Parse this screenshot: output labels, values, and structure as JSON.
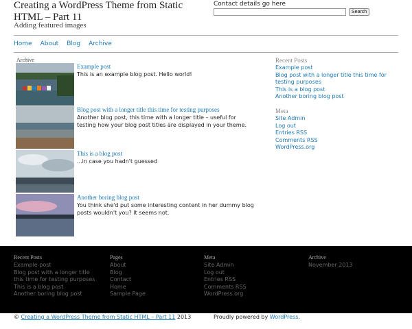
{
  "header": {
    "title": "Creating a WordPress Theme from Static HTML – Part 11",
    "description": "Adding featured images",
    "contact": "Contact details go here",
    "search_placeholder": "",
    "search_label": "Search"
  },
  "nav": [
    "Home",
    "About",
    "Blog",
    "Archive"
  ],
  "archive": {
    "label": "Archive",
    "posts": [
      {
        "title": "Example post",
        "excerpt": "This is an example blog post. Hello world!"
      },
      {
        "title": "Blog post with a longer title this time for testing purposes",
        "excerpt": "Another blog post, this time with a longer title – useful for testing how your blog post titles are displayed in your theme."
      },
      {
        "title": "This is a blog post",
        "excerpt": "...in case you hadn't guessed"
      },
      {
        "title": "Another boring blog post",
        "excerpt": "You think she'd put some interesting content in her dummy blog posts wouldn't you? It seems not."
      }
    ]
  },
  "sidebar": {
    "recent_heading": "Recent Posts",
    "recent": [
      "Example post",
      "Blog post with a longer title this time for testing purposes",
      "This is a blog post",
      "Another boring blog post"
    ],
    "meta_heading": "Meta",
    "meta": [
      "Site Admin",
      "Log out",
      "Entries RSS",
      "Comments RSS",
      "WordPress.org"
    ]
  },
  "footer": {
    "recent_heading": "Recent Posts",
    "recent": [
      "Example post",
      "Blog post with a longer title this time for testing purposes",
      "This is a blog post",
      "Another boring blog post"
    ],
    "pages_heading": "Pages",
    "pages": [
      "About",
      "Blog",
      "Contact",
      "Home",
      "Sample Page"
    ],
    "meta_heading": "Meta",
    "meta": [
      "Site Admin",
      "Log out",
      "Entries RSS",
      "Comments RSS",
      "WordPress.org"
    ],
    "archive_heading": "Archive",
    "archive": [
      "November 2013"
    ]
  },
  "bottom": {
    "copyright_prefix": "©",
    "copyright_link": "Creating a WordPress Theme from Static HTML – Part 11",
    "copyright_year": "2013",
    "powered_prefix": "Proudly powered by",
    "powered_link": "WordPress",
    "powered_suffix": "."
  },
  "colors": {
    "link": "#1a79b7",
    "footer_bg": "#000000",
    "footer_link": "#666666",
    "muted_heading": "#888888"
  }
}
